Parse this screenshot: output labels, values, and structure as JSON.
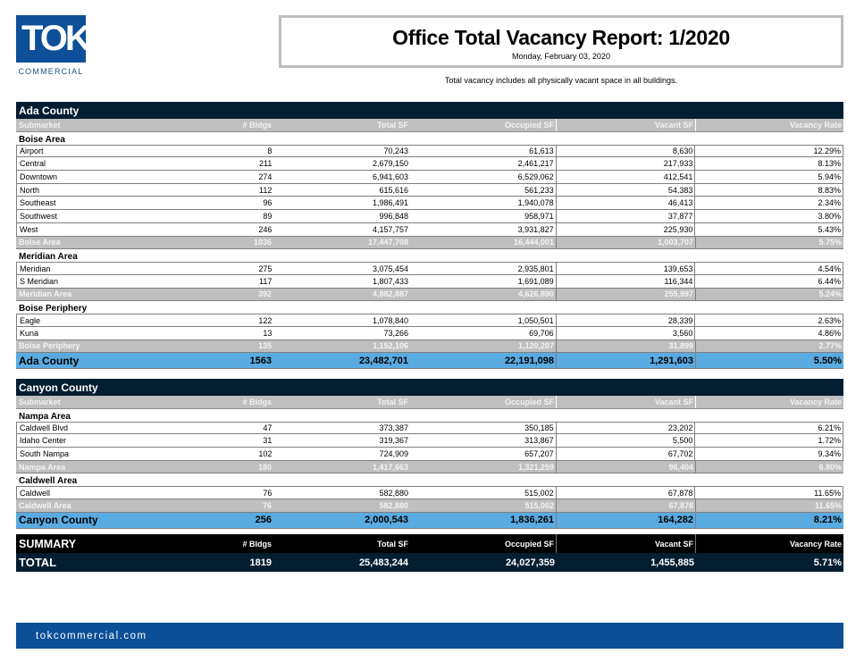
{
  "logo": {
    "mark": "TOK",
    "sub": "COMMERCIAL"
  },
  "header": {
    "title": "Office Total Vacancy Report:  1/2020",
    "date": "Monday, February 03, 2020",
    "note": "Total vacancy includes all physically vacant space in all buildings."
  },
  "columns": [
    "Submarket",
    "# Bldgs",
    "Total SF",
    "Occupied SF",
    "Vacant SF",
    "Vacancy Rate"
  ],
  "counties": [
    {
      "name": "Ada County",
      "areas": [
        {
          "name": "Boise Area",
          "rows": [
            [
              "Airport",
              "8",
              "70,243",
              "61,613",
              "8,630",
              "12.29%"
            ],
            [
              "Central",
              "211",
              "2,679,150",
              "2,461,217",
              "217,933",
              "8.13%"
            ],
            [
              "Downtown",
              "274",
              "6,941,603",
              "6,529,062",
              "412,541",
              "5.94%"
            ],
            [
              "North",
              "112",
              "615,616",
              "561,233",
              "54,383",
              "8.83%"
            ],
            [
              "Southeast",
              "96",
              "1,986,491",
              "1,940,078",
              "46,413",
              "2.34%"
            ],
            [
              "Southwest",
              "89",
              "996,848",
              "958,971",
              "37,877",
              "3.80%"
            ],
            [
              "West",
              "246",
              "4,157,757",
              "3,931,827",
              "225,930",
              "5.43%"
            ]
          ],
          "subtotal": [
            "Boise Area",
            "1036",
            "17,447,708",
            "16,444,001",
            "1,003,707",
            "5.75%"
          ]
        },
        {
          "name": "Meridian Area",
          "rows": [
            [
              "Meridian",
              "275",
              "3,075,454",
              "2,935,801",
              "139,653",
              "4.54%"
            ],
            [
              "S Meridian",
              "117",
              "1,807,433",
              "1,691,089",
              "116,344",
              "6.44%"
            ]
          ],
          "subtotal": [
            "Meridian Area",
            "392",
            "4,882,887",
            "4,626,890",
            "255,997",
            "5.24%"
          ]
        },
        {
          "name": "Boise Periphery",
          "rows": [
            [
              "Eagle",
              "122",
              "1,078,840",
              "1,050,501",
              "28,339",
              "2.63%"
            ],
            [
              "Kuna",
              "13",
              "73,266",
              "69,706",
              "3,560",
              "4.86%"
            ]
          ],
          "subtotal": [
            "Boise Periphery",
            "135",
            "1,152,106",
            "1,120,207",
            "31,899",
            "2.77%"
          ]
        }
      ],
      "total": [
        "Ada County",
        "1563",
        "23,482,701",
        "22,191,098",
        "1,291,603",
        "5.50%"
      ]
    },
    {
      "name": "Canyon County",
      "areas": [
        {
          "name": "Nampa Area",
          "rows": [
            [
              "Caldwell Blvd",
              "47",
              "373,387",
              "350,185",
              "23,202",
              "6.21%"
            ],
            [
              "Idaho Center",
              "31",
              "319,367",
              "313,867",
              "5,500",
              "1.72%"
            ],
            [
              "South Nampa",
              "102",
              "724,909",
              "657,207",
              "67,702",
              "9.34%"
            ]
          ],
          "subtotal": [
            "Nampa Area",
            "180",
            "1,417,663",
            "1,321,259",
            "96,404",
            "6.80%"
          ]
        },
        {
          "name": "Caldwell Area",
          "rows": [
            [
              "Caldwell",
              "76",
              "582,880",
              "515,002",
              "67,878",
              "11.65%"
            ]
          ],
          "subtotal": [
            "Caldwell Area",
            "76",
            "582,880",
            "515,002",
            "67,878",
            "11.65%"
          ]
        }
      ],
      "total": [
        "Canyon County",
        "256",
        "2,000,543",
        "1,836,261",
        "164,282",
        "8.21%"
      ]
    }
  ],
  "summary": {
    "header": [
      "SUMMARY",
      "# Bldgs",
      "Total SF",
      "Occupied SF",
      "Vacant SF",
      "Vacancy Rate"
    ],
    "total": [
      "TOTAL",
      "1819",
      "25,483,244",
      "24,027,359",
      "1,455,885",
      "5.71%"
    ]
  },
  "footer": {
    "url": "tokcommercial.com"
  },
  "colors": {
    "brand_blue": "#0d4f98",
    "county_header": "#031d31",
    "subheader_gray": "#bfbfbf",
    "county_total_blue": "#5aabe1"
  }
}
